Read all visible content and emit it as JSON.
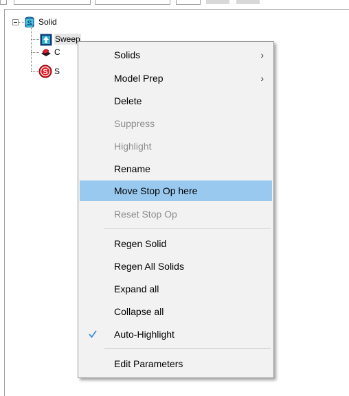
{
  "tree": {
    "root_label": "Solid",
    "children": [
      {
        "label": "Sweep"
      },
      {
        "label": "C"
      },
      {
        "label": "S"
      }
    ]
  },
  "context_menu": {
    "items": [
      {
        "label": "Solids",
        "state": "enabled",
        "submenu": true
      },
      {
        "label": "Model Prep",
        "state": "enabled",
        "submenu": true
      },
      {
        "label": "Delete",
        "state": "enabled"
      },
      {
        "label": "Suppress",
        "state": "disabled"
      },
      {
        "label": "Highlight",
        "state": "disabled"
      },
      {
        "label": "Rename",
        "state": "enabled"
      },
      {
        "label": "Move Stop Op here",
        "state": "hovered"
      },
      {
        "label": "Reset Stop Op",
        "state": "disabled"
      },
      {
        "label": "Regen Solid",
        "state": "enabled"
      },
      {
        "label": "Regen All Solids",
        "state": "enabled"
      },
      {
        "label": "Expand all",
        "state": "enabled"
      },
      {
        "label": "Collapse all",
        "state": "enabled"
      },
      {
        "label": "Auto-Highlight",
        "state": "checked"
      },
      {
        "label": "Edit Parameters",
        "state": "enabled"
      }
    ],
    "submenu_arrow": "›",
    "check_icon": "check-icon"
  },
  "colors": {
    "menu_bg": "#f2f2f2",
    "hover_bg": "#99c9ef",
    "disabled_text": "#8d8d8d",
    "check": "#3b8de0"
  }
}
